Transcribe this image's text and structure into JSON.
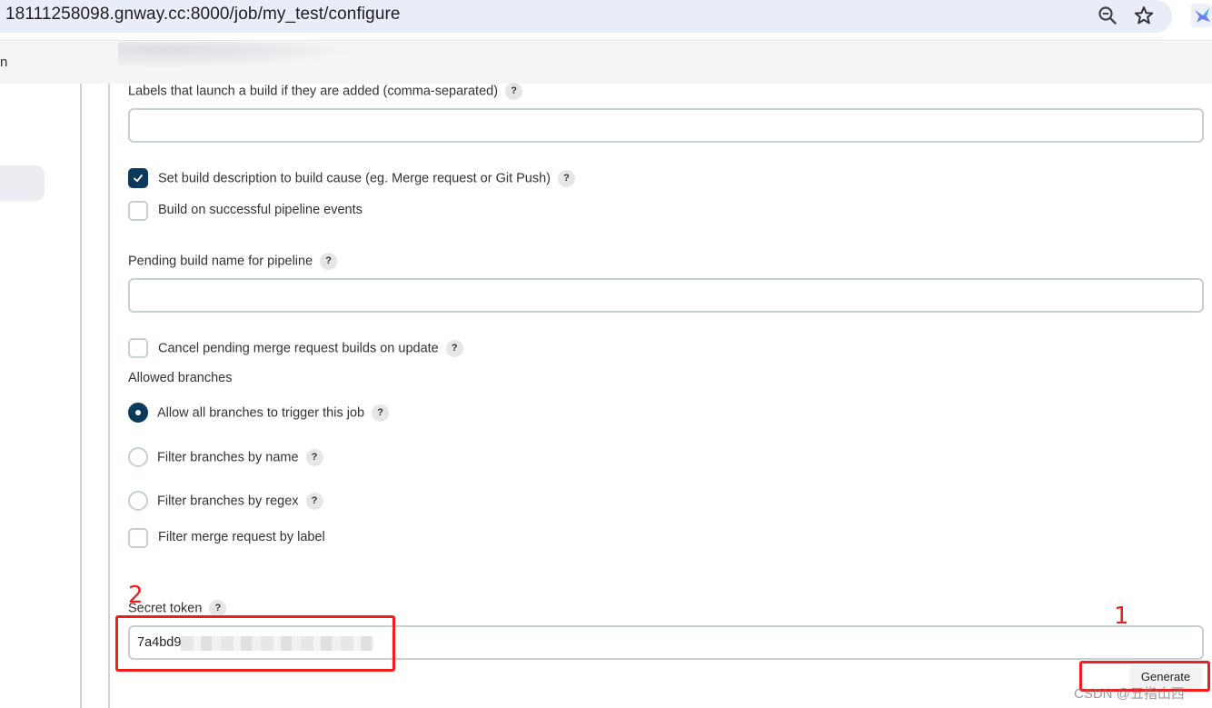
{
  "browser": {
    "url": "18111258098.gnway.cc:8000/job/my_test/configure",
    "icons": [
      "zoom-out-icon",
      "bookmark-star-icon",
      "extension-bird-icon"
    ]
  },
  "header": {
    "breadcrumb_fragment": "n"
  },
  "form": {
    "labels_added": {
      "label": "Labels that launch a build if they are added (comma-separated)",
      "value": "",
      "help": "?"
    },
    "set_build_description": {
      "label": "Set build description to build cause (eg. Merge request or Git Push)",
      "checked": true,
      "help": "?"
    },
    "build_on_pipeline": {
      "label": "Build on successful pipeline events",
      "checked": false
    },
    "pending_build_name": {
      "label": "Pending build name for pipeline",
      "value": "",
      "help": "?"
    },
    "cancel_pending": {
      "label": "Cancel pending merge request builds on update",
      "checked": false,
      "help": "?"
    },
    "allowed_branches": {
      "heading": "Allowed branches",
      "options": [
        {
          "label": "Allow all branches to trigger this job",
          "selected": true,
          "help": "?"
        },
        {
          "label": "Filter branches by name",
          "selected": false,
          "help": "?"
        },
        {
          "label": "Filter branches by regex",
          "selected": false,
          "help": "?"
        }
      ]
    },
    "filter_by_label": {
      "label": "Filter merge request by label",
      "checked": false
    },
    "secret_token": {
      "label": "Secret token",
      "help": "?",
      "value_visible": "7a4bd9",
      "value_obscured": true
    },
    "generate_button": "Generate"
  },
  "annotations": {
    "step1": "1",
    "step2": "2",
    "color": "#f21c1c"
  },
  "watermark": "CSDN @五指山西",
  "colors": {
    "accent": "#0b3a5b",
    "border": "#c7d0d3",
    "help_bg": "#e6e6e6",
    "omnibox_bg": "#e9edf8"
  }
}
